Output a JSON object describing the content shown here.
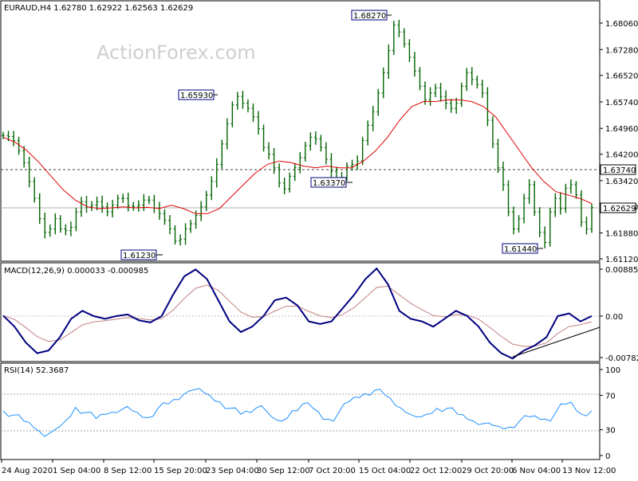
{
  "header": {
    "symbol_line": "EURAUD,H4  1.62780 1.62922 1.62563 1.62629",
    "watermark": "ActionForex.com"
  },
  "price_panel": {
    "y_ticks": [
      "1.68060",
      "1.67280",
      "1.66520",
      "1.65740",
      "1.64960",
      "1.64200",
      "1.63420",
      "1.62660",
      "1.61880",
      "1.61120"
    ],
    "current_price_tag": "1.62629",
    "level_tag": "1.63740",
    "annotations": {
      "a1": "1.65930",
      "a2": "1.61230",
      "a3": "1.68270",
      "a4": "1.63370",
      "a5": "1.61440"
    }
  },
  "macd_panel": {
    "title": "MACD(12,26,9) 0.000033 -0.000985",
    "y_ticks": [
      "0.008859",
      "0.00",
      "-0.007826"
    ]
  },
  "rsi_panel": {
    "title": "RSI(14) 52.3687",
    "y_ticks": [
      "100",
      "70",
      "30",
      "0"
    ]
  },
  "x_axis": {
    "labels": [
      "24 Aug 2020",
      "1 Sep 04:00",
      "8 Sep 12:00",
      "15 Sep 20:00",
      "23 Sep 04:00",
      "30 Sep 12:00",
      "7 Oct 20:00",
      "15 Oct 04:00",
      "22 Oct 12:00",
      "29 Oct 20:00",
      "6 Nov 04:00",
      "13 Nov 12:00"
    ]
  },
  "colors": {
    "price_bars": "#006400",
    "moving_average": "#e00000",
    "macd_line": "#000080",
    "signal_line": "#c08080",
    "rsi_line": "#1e90ff",
    "trendline": "#000000",
    "tag_border": "#000080"
  },
  "chart_data": {
    "type": "line",
    "price": {
      "close": [
        1.6475,
        1.6472,
        1.646,
        1.643,
        1.6395,
        1.634,
        1.629,
        1.623,
        1.619,
        1.62,
        1.623,
        1.62,
        1.6195,
        1.6205,
        1.625,
        1.628,
        1.6265,
        1.627,
        1.628,
        1.6265,
        1.625,
        1.627,
        1.629,
        1.629,
        1.6268,
        1.6265,
        1.627,
        1.6285,
        1.6285,
        1.6262,
        1.6245,
        1.6225,
        1.62,
        1.6165,
        1.617,
        1.62,
        1.6215,
        1.624,
        1.6265,
        1.63,
        1.634,
        1.639,
        1.645,
        1.651,
        1.6565,
        1.659,
        1.657,
        1.6555,
        1.653,
        1.6495,
        1.644,
        1.642,
        1.638,
        1.6335,
        1.6318,
        1.6355,
        1.638,
        1.641,
        1.6445,
        1.647,
        1.6465,
        1.644,
        1.6405,
        1.637,
        1.6337,
        1.6352,
        1.6385,
        1.639,
        1.64,
        1.646,
        1.6505,
        1.6545,
        1.66,
        1.666,
        1.6725,
        1.68,
        1.678,
        1.6745,
        1.6705,
        1.6665,
        1.662,
        1.658,
        1.66,
        1.6615,
        1.659,
        1.657,
        1.6555,
        1.657,
        1.662,
        1.666,
        1.664,
        1.6625,
        1.66,
        1.652,
        1.645,
        1.638,
        1.633,
        1.625,
        1.62,
        1.623,
        1.629,
        1.633,
        1.625,
        1.619,
        1.616,
        1.625,
        1.629,
        1.626,
        1.632,
        1.633,
        1.63,
        1.622,
        1.62,
        1.6263
      ]
    },
    "moving_average": [
      1.647,
      1.6455,
      1.643,
      1.6395,
      1.6355,
      1.6315,
      1.6285,
      1.6265,
      1.626,
      1.6262,
      1.6265,
      1.6262,
      1.6264,
      1.626,
      1.627,
      1.626,
      1.6245,
      1.6245,
      1.626,
      1.6295,
      1.633,
      1.6365,
      1.639,
      1.64,
      1.6395,
      1.6385,
      1.638,
      1.6385,
      1.638,
      1.638,
      1.64,
      1.643,
      1.647,
      1.652,
      1.656,
      1.6575,
      1.6575,
      1.658,
      1.658,
      1.6575,
      1.656,
      1.653,
      1.648,
      1.643,
      1.638,
      1.634,
      1.631,
      1.63,
      1.629,
      1.6275
    ],
    "macd": [
      0.0001,
      -0.002,
      -0.005,
      -0.007,
      -0.0065,
      -0.004,
      -0.0005,
      0.001,
      0.0,
      -0.0005,
      0.0,
      0.0003,
      -0.0008,
      -0.0012,
      0.0,
      0.004,
      0.0075,
      0.0088,
      0.007,
      0.003,
      -0.001,
      -0.003,
      -0.002,
      0.0,
      0.003,
      0.0035,
      0.002,
      -0.001,
      -0.0015,
      -0.001,
      0.0015,
      0.004,
      0.007,
      0.009,
      0.006,
      0.001,
      -0.0005,
      -0.001,
      -0.002,
      -0.0005,
      0.001,
      0.0,
      -0.002,
      -0.005,
      -0.007,
      -0.008,
      -0.0065,
      -0.0055,
      -0.004,
      0.0,
      0.0005,
      -0.001,
      0.0
    ],
    "rsi": [
      52,
      47,
      40,
      32,
      22,
      30,
      40,
      56,
      50,
      43,
      48,
      50,
      57,
      50,
      44,
      55,
      60,
      65,
      75,
      78,
      70,
      62,
      55,
      48,
      50,
      58,
      45,
      40,
      52,
      60,
      55,
      42,
      40,
      60,
      68,
      72,
      76,
      70,
      58,
      50,
      45,
      48,
      55,
      55,
      48,
      42,
      36,
      38,
      34,
      33,
      40,
      45,
      42,
      40,
      60,
      62,
      48,
      52
    ]
  }
}
